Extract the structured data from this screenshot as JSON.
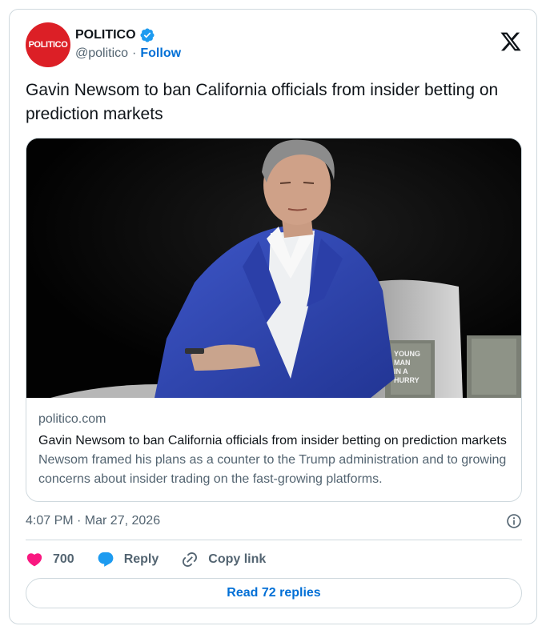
{
  "account": {
    "avatar_text": "POLITICO",
    "name": "POLITICO",
    "handle": "@politico",
    "separator": "·",
    "follow_label": "Follow",
    "brand_color": "#dc1f26",
    "verified_icon": "verified-badge-icon"
  },
  "tweet": {
    "text": "Gavin Newsom to ban California officials from insider betting on prediction markets"
  },
  "link_card": {
    "domain": "politico.com",
    "title": "Gavin Newsom to ban California officials from insider betting on prediction markets",
    "description": "Newsom framed his plans as a counter to the Trump administration and to growing concerns about insider trading on the fast-growing platforms.",
    "book_cover_text": [
      "YOUNG",
      "MAN",
      "IN A",
      "HURRY"
    ]
  },
  "timestamp": "4:07 PM · Mar 27, 2026",
  "actions": {
    "like_count": "700",
    "reply_label": "Reply",
    "copy_label": "Copy link"
  },
  "read_replies_label": "Read 72 replies",
  "colors": {
    "link_blue": "#006fd6",
    "heart_pink": "#f91880",
    "reply_blue": "#1d9bf0",
    "secondary_text": "#536471",
    "border": "#cfd9de"
  }
}
